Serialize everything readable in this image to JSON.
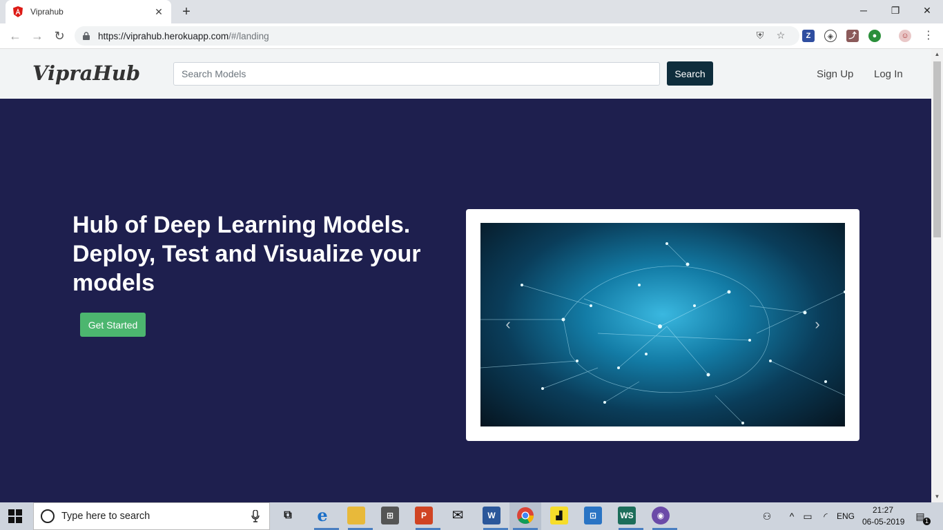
{
  "browser": {
    "tab_title": "Viprahub",
    "url_host": "https://viprahub.herokuapp.com",
    "url_path": "/#/landing"
  },
  "site": {
    "brand": "VipraHub",
    "search_placeholder": "Search Models",
    "search_button": "Search",
    "nav": {
      "signup": "Sign Up",
      "login": "Log In"
    }
  },
  "hero": {
    "title": "Hub of Deep Learning Models. Deploy, Test and Visualize your models",
    "cta": "Get Started",
    "carousel": {
      "prev_icon": "chevron-left-icon",
      "next_icon": "chevron-right-icon"
    }
  },
  "taskbar": {
    "search_placeholder": "Type here to search",
    "language": "ENG",
    "time": "21:27",
    "date": "06-05-2019",
    "notification_count": "1"
  },
  "colors": {
    "hero_bg": "#1e1f4e",
    "search_button": "#0f2d3c",
    "cta": "#4cb66f",
    "nav_bg": "#f2f4f5"
  }
}
